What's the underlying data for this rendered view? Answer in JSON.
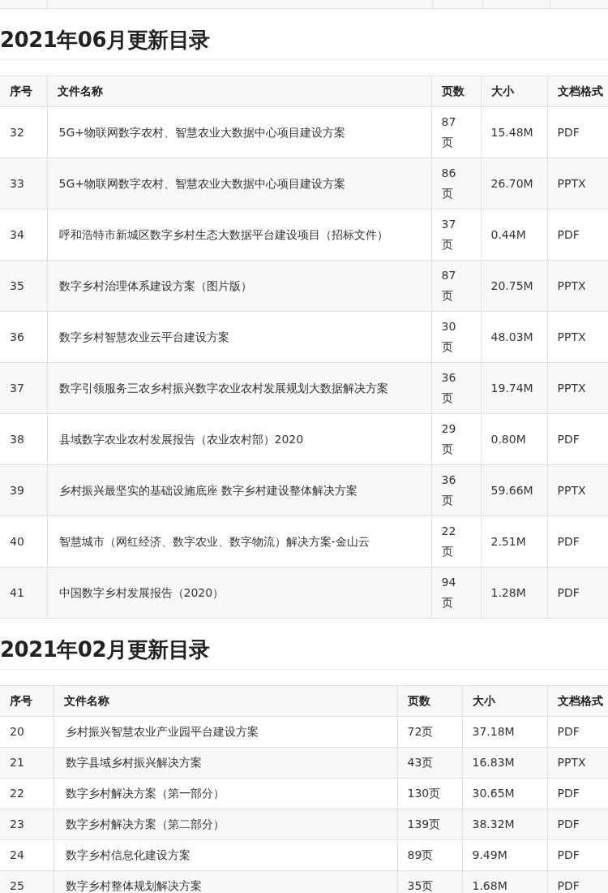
{
  "sections": [
    {
      "heading": "2021年06月更新目录",
      "columns": [
        "序号",
        "文件名称",
        "页数",
        "大小",
        "文档格式"
      ],
      "rows": [
        [
          "32",
          "5G+物联网数字农村、智慧农业大数据中心项目建设方案",
          "87页",
          "15.48M",
          "PDF"
        ],
        [
          "33",
          "5G+物联网数字农村、智慧农业大数据中心项目建设方案",
          "86页",
          "26.70M",
          "PPTX"
        ],
        [
          "34",
          "呼和浩特市新城区数字乡村生态大数据平台建设项目（招标文件）",
          "37页",
          "0.44M",
          "PDF"
        ],
        [
          "35",
          "数字乡村治理体系建设方案（图片版）",
          "87页",
          "20.75M",
          "PPTX"
        ],
        [
          "36",
          "数字乡村智慧农业云平台建设方案",
          "30页",
          "48.03M",
          "PPTX"
        ],
        [
          "37",
          "数字引领服务三农乡村振兴数字农业农村发展规划大数据解决方案",
          "36页",
          "19.74M",
          "PPTX"
        ],
        [
          "38",
          "县域数字农业农村发展报告（农业农村部）2020",
          "29页",
          "0.80M",
          "PDF"
        ],
        [
          "39",
          "乡村振兴最坚实的基础设施底座 数字乡村建设整体解决方案",
          "36页",
          "59.66M",
          "PPTX"
        ],
        [
          "40",
          "智慧城市（网红经济、数字农业、数字物流）解决方案-金山云",
          "22页",
          "2.51M",
          "PDF"
        ],
        [
          "41",
          "中国数字乡村发展报告（2020）",
          "94页",
          "1.28M",
          "PDF"
        ]
      ]
    },
    {
      "heading": "2021年02月更新目录",
      "columns": [
        "序号",
        "文件名称",
        "页数",
        "大小",
        "文档格式"
      ],
      "rows": [
        [
          "20",
          "乡村振兴智慧农业产业园平台建设方案",
          "72页",
          "37.18M",
          "PDF"
        ],
        [
          "21",
          "数字县域乡村振兴解决方案",
          "43页",
          "16.83M",
          "PPTX"
        ],
        [
          "22",
          "数字乡村解决方案（第一部分）",
          "130页",
          "30.65M",
          "PDF"
        ],
        [
          "23",
          "数字乡村解决方案（第二部分）",
          "139页",
          "38.32M",
          "PDF"
        ],
        [
          "24",
          "数字乡村信息化建设方案",
          "89页",
          "9.49M",
          "PDF"
        ],
        [
          "25",
          "数字乡村整体规划解决方案",
          "35页",
          "1.68M",
          "PDF"
        ]
      ]
    }
  ]
}
